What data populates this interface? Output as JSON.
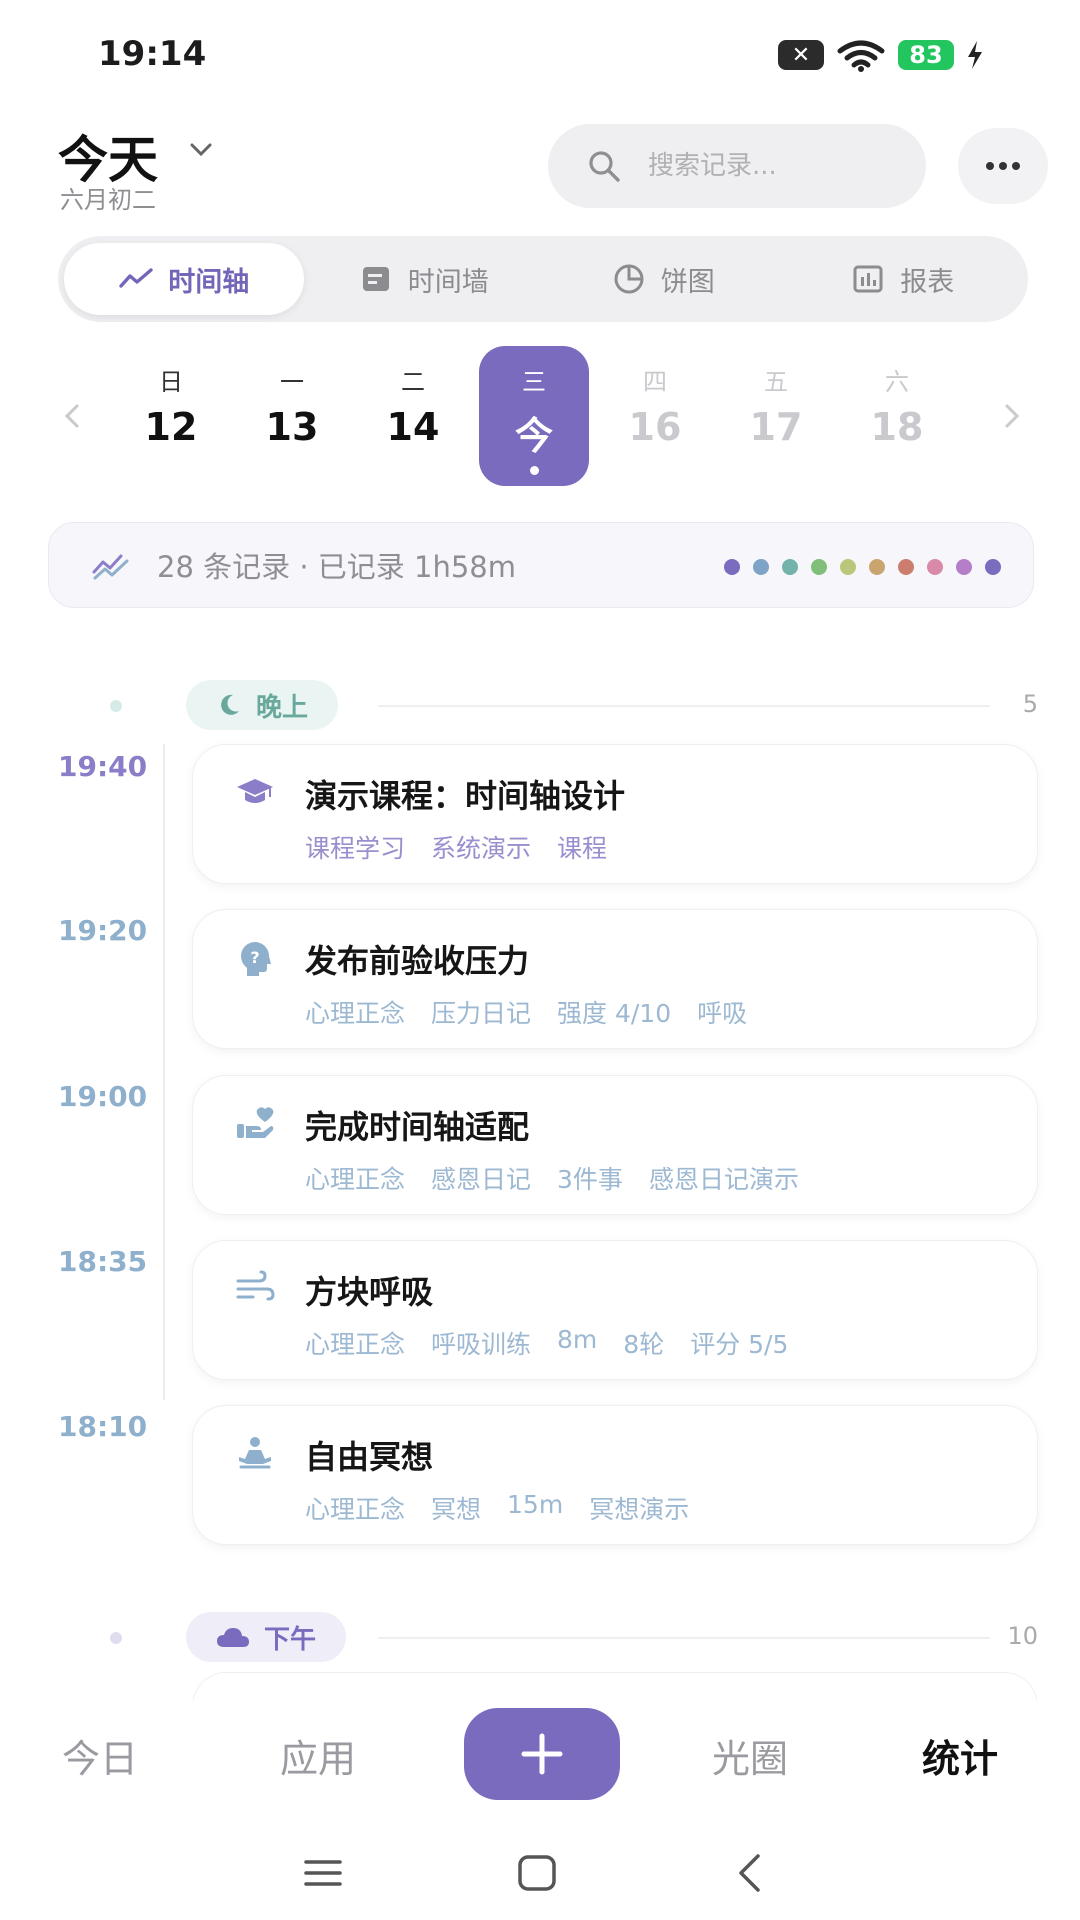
{
  "status_bar": {
    "time": "19:14",
    "battery": "83"
  },
  "header": {
    "title": "今天",
    "subtitle": "六月初二",
    "search_placeholder": "搜索记录..."
  },
  "tabs": [
    {
      "label": "时间轴",
      "icon": "trend-line-icon",
      "active": true
    },
    {
      "label": "时间墙",
      "icon": "notes-icon",
      "active": false
    },
    {
      "label": "饼图",
      "icon": "pie-chart-icon",
      "active": false
    },
    {
      "label": "报表",
      "icon": "bar-report-icon",
      "active": false
    }
  ],
  "week": [
    {
      "dow": "日",
      "num": "12",
      "state": "past"
    },
    {
      "dow": "一",
      "num": "13",
      "state": "past"
    },
    {
      "dow": "二",
      "num": "14",
      "state": "past"
    },
    {
      "dow": "三",
      "num": "今",
      "state": "today"
    },
    {
      "dow": "四",
      "num": "16",
      "state": "future"
    },
    {
      "dow": "五",
      "num": "17",
      "state": "future"
    },
    {
      "dow": "六",
      "num": "18",
      "state": "future"
    }
  ],
  "summary": {
    "text": "28 条记录 · 已记录 1h58m",
    "dot_colors": [
      "#7c6cc0",
      "#7fa3c6",
      "#74b3aa",
      "#7fbf7a",
      "#b9c77a",
      "#c9a46e",
      "#cc7d6e",
      "#d88aa8",
      "#b47fc8",
      "#7c6cc0"
    ]
  },
  "sections": {
    "evening": {
      "label": "晚上",
      "count": "5"
    },
    "afternoon": {
      "label": "下午",
      "count": "10"
    }
  },
  "entries": [
    {
      "time": "19:40",
      "title": "演示课程：时间轴设计",
      "icon": "graduation-cap-icon",
      "tags": [
        "课程学习",
        "系统演示",
        "课程"
      ],
      "accent": "#8b7dc8"
    },
    {
      "time": "19:20",
      "title": "发布前验收压力",
      "icon": "head-question-icon",
      "tags": [
        "心理正念",
        "压力日记",
        "强度 4/10",
        "呼吸"
      ],
      "accent": "#8fb0cc"
    },
    {
      "time": "19:00",
      "title": "完成时间轴适配",
      "icon": "hand-heart-icon",
      "tags": [
        "心理正念",
        "感恩日记",
        "3件事",
        "感恩日记演示"
      ],
      "accent": "#8fb0cc"
    },
    {
      "time": "18:35",
      "title": "方块呼吸",
      "icon": "wind-icon",
      "tags": [
        "心理正念",
        "呼吸训练",
        "8m",
        "8轮",
        "评分 5/5"
      ],
      "accent": "#8fb0cc"
    },
    {
      "time": "18:10",
      "title": "自由冥想",
      "icon": "meditation-icon",
      "tags": [
        "心理正念",
        "冥想",
        "15m",
        "冥想演示"
      ],
      "accent": "#8fb0cc"
    }
  ],
  "bottom_nav": {
    "today": "今日",
    "apps": "应用",
    "aperture": "光圈",
    "stats": "统计"
  },
  "colors": {
    "accent": "#7a6bbe",
    "teal": "#6aa89e"
  }
}
